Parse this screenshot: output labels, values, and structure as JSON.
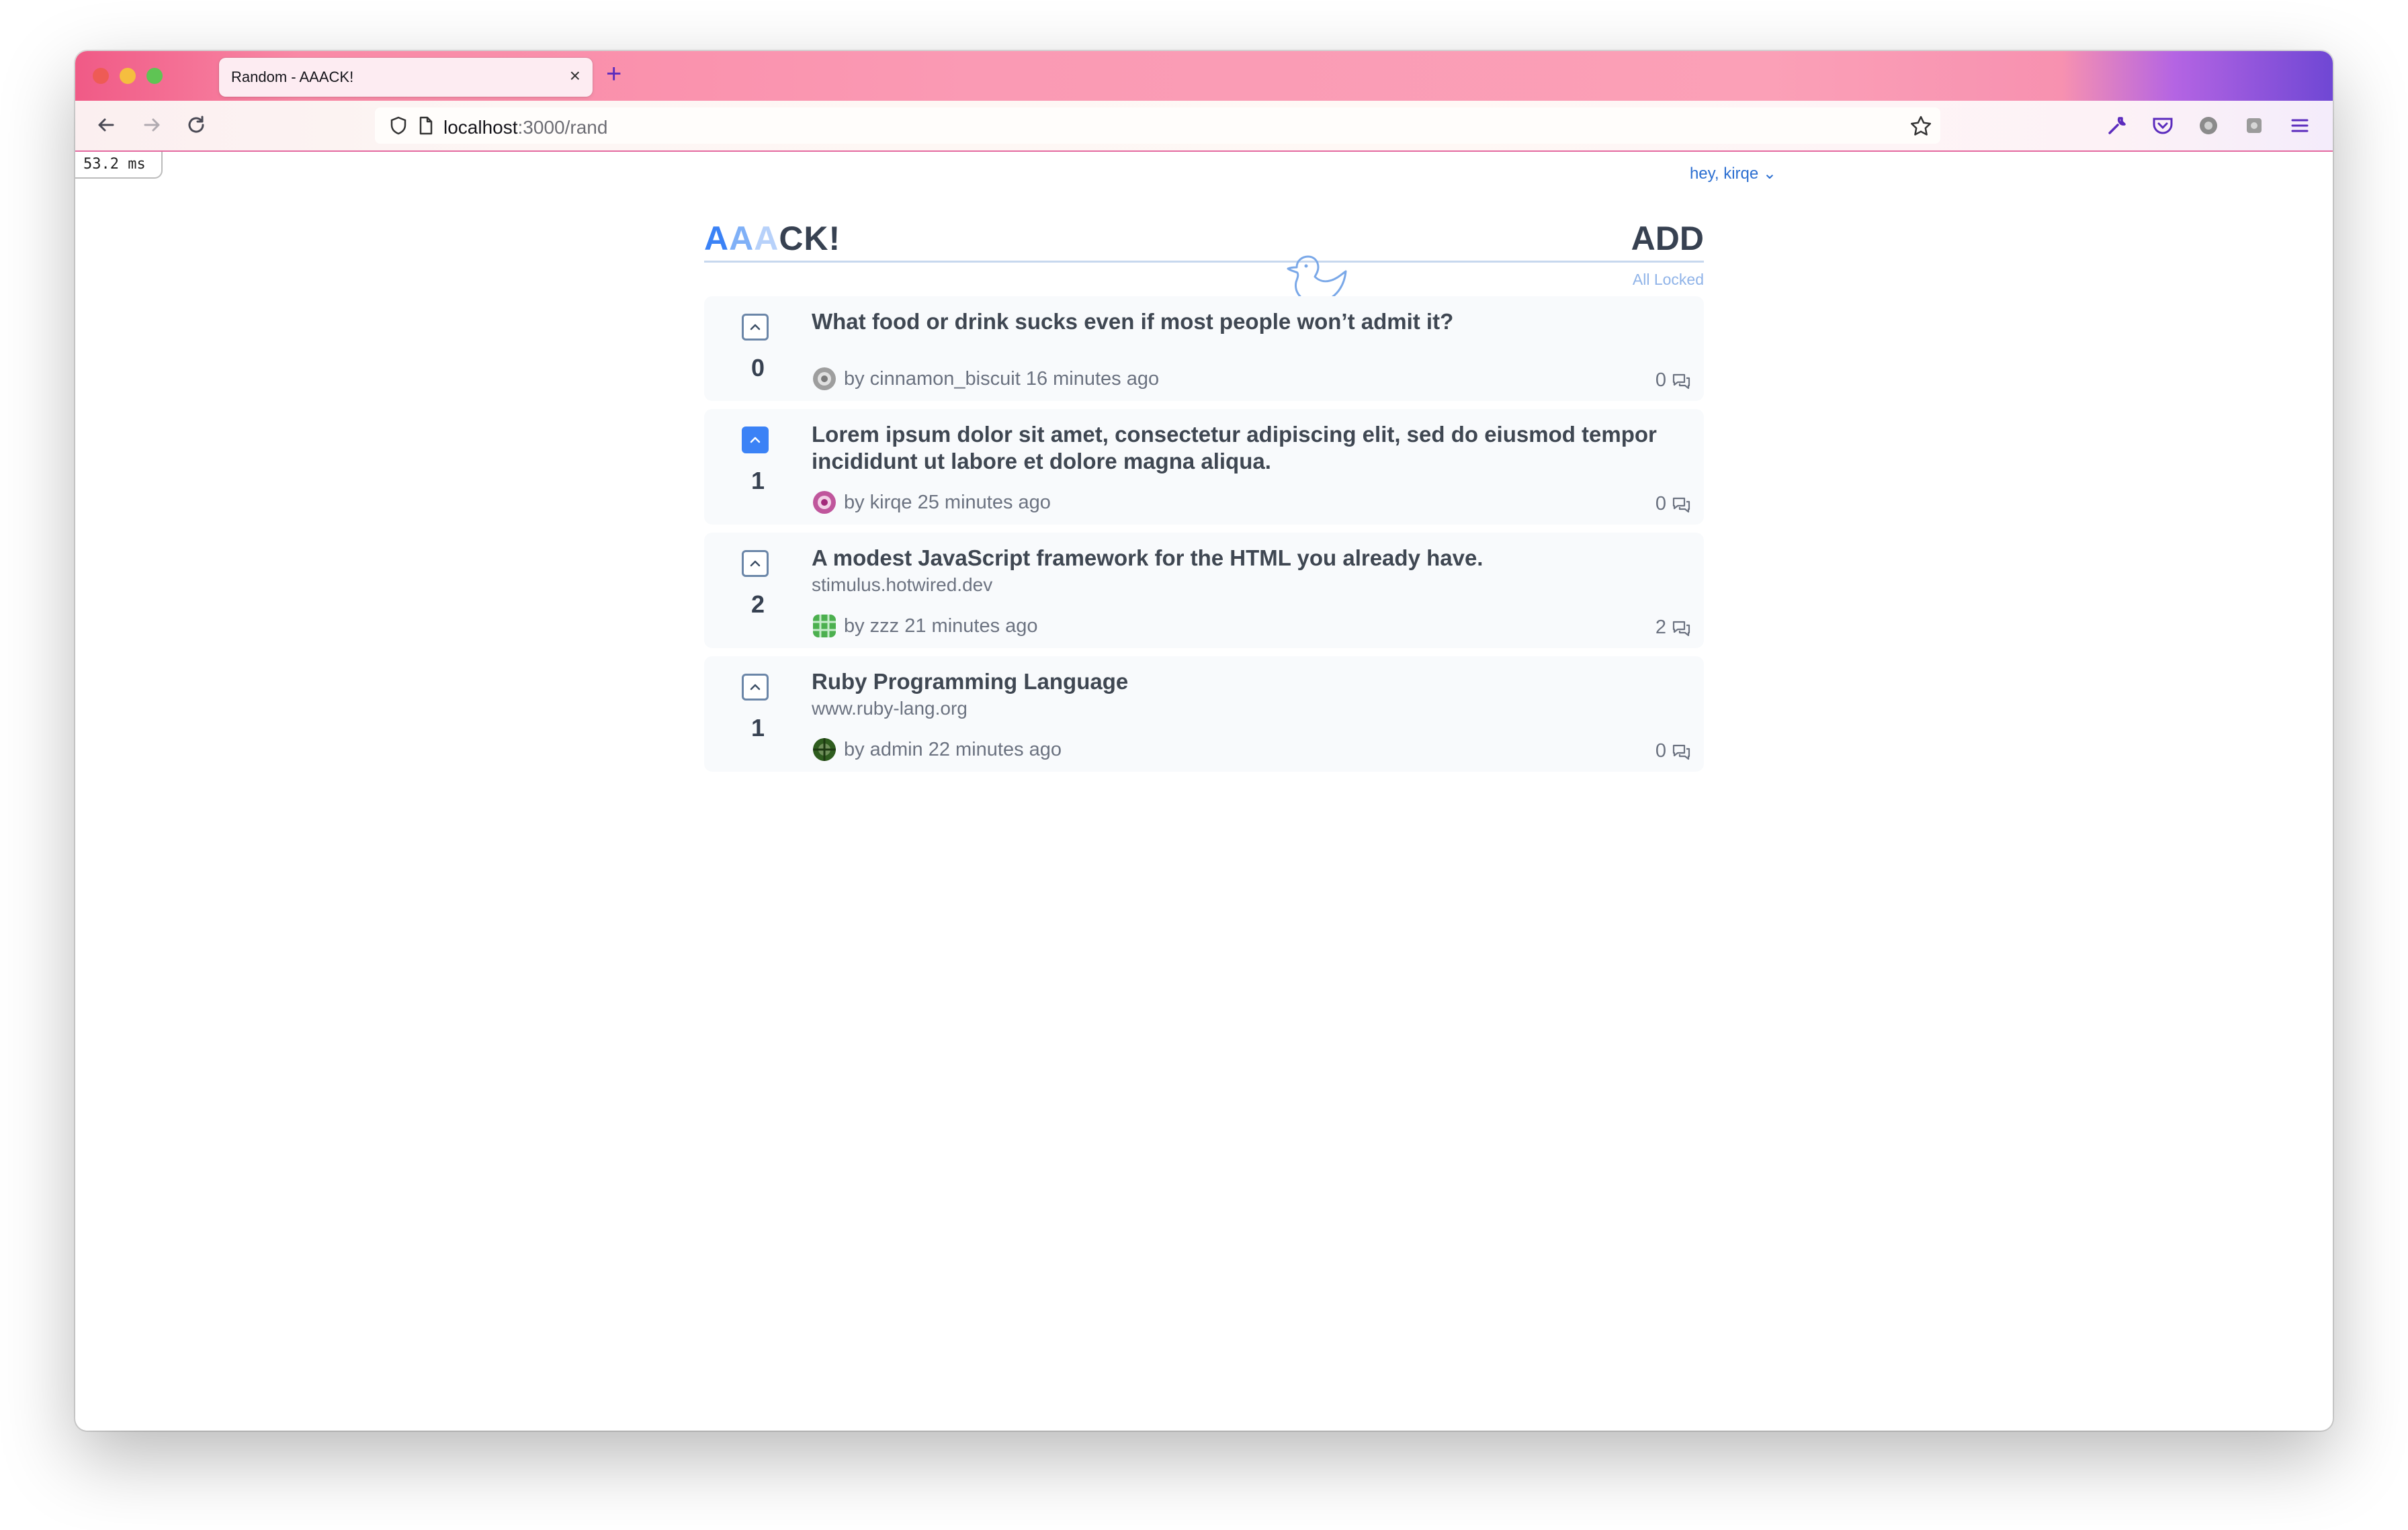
{
  "browser": {
    "tab_title": "Random - AAACK!",
    "tab_close": "×",
    "new_tab": "+",
    "url_host": "localhost",
    "url_path": ":3000/rand",
    "timing": "53.2 ms"
  },
  "site": {
    "greeting": "hey, kirqe",
    "logo": [
      "A",
      "A",
      "A",
      "CK!"
    ],
    "add_label": "ADD",
    "filter_label": "All Locked"
  },
  "stories": [
    {
      "score": "0",
      "upvoted": false,
      "title": "What food or drink sucks even if most people won’t admit it?",
      "domain": "",
      "meta": "by cinnamon_biscuit 16 minutes ago",
      "comments": "0"
    },
    {
      "score": "1",
      "upvoted": true,
      "title": "Lorem ipsum dolor sit amet, consectetur adipiscing elit, sed do eiusmod tempor incididunt ut labore et dolore magna aliqua.",
      "domain": "",
      "meta": "by kirqe 25 minutes ago",
      "comments": "0"
    },
    {
      "score": "2",
      "upvoted": false,
      "title": "A modest JavaScript framework for the HTML you already have.",
      "domain": "stimulus.hotwired.dev",
      "meta": "by zzz 21 minutes ago",
      "comments": "2"
    },
    {
      "score": "1",
      "upvoted": false,
      "title": "Ruby Programming Language",
      "domain": "www.ruby-lang.org",
      "meta": "by admin 22 minutes ago",
      "comments": "0"
    }
  ],
  "colors": {
    "accent": "#3b82f6",
    "text_dark": "#374151",
    "text_muted": "#6b7280",
    "avatar_colors": [
      "#8a8a8a",
      "#a3297a",
      "#3aa142",
      "#2f5d1f"
    ]
  },
  "icons": {
    "back": "back-arrow-icon",
    "forward": "forward-arrow-icon",
    "reload": "reload-icon",
    "shield": "shield-icon",
    "page": "page-icon",
    "bookmark": "star-icon",
    "upvote": "chevron-up-icon",
    "comments": "comment-bubble-icon",
    "logo_bird": "bird-icon"
  }
}
